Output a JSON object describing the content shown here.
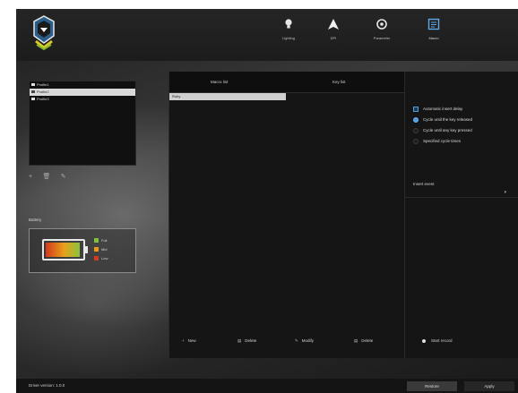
{
  "nav": [
    {
      "label": "Lighting",
      "icon": "bulb-icon"
    },
    {
      "label": "DPI",
      "icon": "arrow-icon"
    },
    {
      "label": "Parameter",
      "icon": "gear-icon"
    },
    {
      "label": "Macro",
      "icon": "macro-icon"
    }
  ],
  "profiles": [
    "Profile1",
    "Profile2",
    "Profile3"
  ],
  "selected_profile": "Profile2",
  "battery": {
    "title": "Battery",
    "level_fraction": 0.95,
    "legend": [
      {
        "label": "Full",
        "color": "#7dc23a"
      },
      {
        "label": "Mid",
        "color": "#e89a1b"
      },
      {
        "label": "Low",
        "color": "#d63a1e"
      }
    ]
  },
  "macro": {
    "macro_list_header": "Macro list",
    "key_list_header": "Key list",
    "items": [
      "Ruby"
    ],
    "bottom_buttons": [
      "New",
      "Delete",
      "Modify",
      "Delete"
    ]
  },
  "options": {
    "auto_delay": "Automatic insert delay",
    "cycle_release": "Cycle until the key released",
    "cycle_any_key": "Cycle until any key pressed",
    "specified_times": "Specified cycle times",
    "insert_event_label": "Insert event",
    "start_record": "Start record"
  },
  "status": {
    "driver_version": "Driver version: 1.0.0",
    "restore": "Restore",
    "apply": "Apply"
  },
  "colors": {
    "accent": "#4d9de0"
  }
}
